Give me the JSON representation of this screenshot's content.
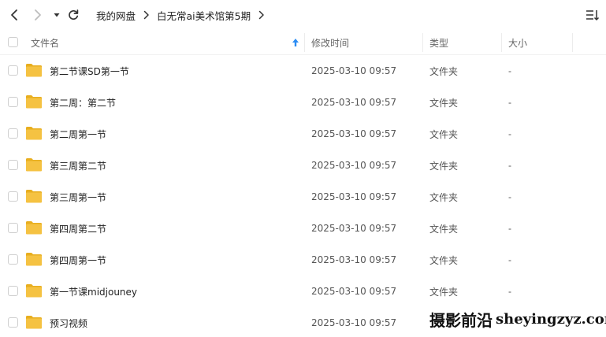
{
  "toolbar": {
    "back_icon": "chevron-left-icon",
    "forward_icon": "chevron-right-icon",
    "history_dropdown_icon": "caret-down-icon",
    "refresh_icon": "refresh-icon",
    "sort_icon": "sort-list-icon"
  },
  "breadcrumb": {
    "items": [
      "我的网盘",
      "白无常ai美术馆第5期"
    ],
    "separator_icon": "chevron-right-icon"
  },
  "table": {
    "columns": {
      "name": "文件名",
      "modified": "修改时间",
      "type": "类型",
      "size": "大小"
    },
    "sort_indicator_icon": "arrow-up-icon",
    "rows": [
      {
        "name": "第二节课SD第一节",
        "modified": "2025-03-10 09:57",
        "type": "文件夹",
        "size": "-"
      },
      {
        "name": "第二周：第二节",
        "modified": "2025-03-10 09:57",
        "type": "文件夹",
        "size": "-"
      },
      {
        "name": "第二周第一节",
        "modified": "2025-03-10 09:57",
        "type": "文件夹",
        "size": "-"
      },
      {
        "name": "第三周第二节",
        "modified": "2025-03-10 09:57",
        "type": "文件夹",
        "size": "-"
      },
      {
        "name": "第三周第一节",
        "modified": "2025-03-10 09:57",
        "type": "文件夹",
        "size": "-"
      },
      {
        "name": "第四周第二节",
        "modified": "2025-03-10 09:57",
        "type": "文件夹",
        "size": "-"
      },
      {
        "name": "第四周第一节",
        "modified": "2025-03-10 09:57",
        "type": "文件夹",
        "size": "-"
      },
      {
        "name": "第一节课midjouney",
        "modified": "2025-03-10 09:57",
        "type": "文件夹",
        "size": "-"
      },
      {
        "name": "预习视频",
        "modified": "2025-03-10 09:57",
        "type": "文件夹",
        "size": "-"
      }
    ],
    "row_icon": "folder-icon"
  },
  "watermark": {
    "cn": "摄影前沿",
    "latin": "sheyingzyz.com"
  },
  "colors": {
    "folder": "#F5C242",
    "folder_dark": "#E8AE1F",
    "accent_sort": "#2C8DF4",
    "text": "#222222",
    "muted": "#666666"
  }
}
